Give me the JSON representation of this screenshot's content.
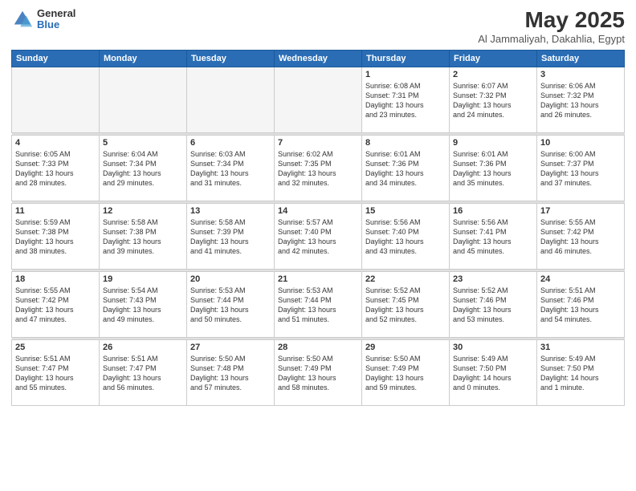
{
  "header": {
    "logo_general": "General",
    "logo_blue": "Blue",
    "title": "May 2025",
    "subtitle": "Al Jammaliyah, Dakahlia, Egypt"
  },
  "days_of_week": [
    "Sunday",
    "Monday",
    "Tuesday",
    "Wednesday",
    "Thursday",
    "Friday",
    "Saturday"
  ],
  "weeks": [
    [
      {
        "day": "",
        "info": ""
      },
      {
        "day": "",
        "info": ""
      },
      {
        "day": "",
        "info": ""
      },
      {
        "day": "",
        "info": ""
      },
      {
        "day": "1",
        "info": "Sunrise: 6:08 AM\nSunset: 7:31 PM\nDaylight: 13 hours\nand 23 minutes."
      },
      {
        "day": "2",
        "info": "Sunrise: 6:07 AM\nSunset: 7:32 PM\nDaylight: 13 hours\nand 24 minutes."
      },
      {
        "day": "3",
        "info": "Sunrise: 6:06 AM\nSunset: 7:32 PM\nDaylight: 13 hours\nand 26 minutes."
      }
    ],
    [
      {
        "day": "4",
        "info": "Sunrise: 6:05 AM\nSunset: 7:33 PM\nDaylight: 13 hours\nand 28 minutes."
      },
      {
        "day": "5",
        "info": "Sunrise: 6:04 AM\nSunset: 7:34 PM\nDaylight: 13 hours\nand 29 minutes."
      },
      {
        "day": "6",
        "info": "Sunrise: 6:03 AM\nSunset: 7:34 PM\nDaylight: 13 hours\nand 31 minutes."
      },
      {
        "day": "7",
        "info": "Sunrise: 6:02 AM\nSunset: 7:35 PM\nDaylight: 13 hours\nand 32 minutes."
      },
      {
        "day": "8",
        "info": "Sunrise: 6:01 AM\nSunset: 7:36 PM\nDaylight: 13 hours\nand 34 minutes."
      },
      {
        "day": "9",
        "info": "Sunrise: 6:01 AM\nSunset: 7:36 PM\nDaylight: 13 hours\nand 35 minutes."
      },
      {
        "day": "10",
        "info": "Sunrise: 6:00 AM\nSunset: 7:37 PM\nDaylight: 13 hours\nand 37 minutes."
      }
    ],
    [
      {
        "day": "11",
        "info": "Sunrise: 5:59 AM\nSunset: 7:38 PM\nDaylight: 13 hours\nand 38 minutes."
      },
      {
        "day": "12",
        "info": "Sunrise: 5:58 AM\nSunset: 7:38 PM\nDaylight: 13 hours\nand 39 minutes."
      },
      {
        "day": "13",
        "info": "Sunrise: 5:58 AM\nSunset: 7:39 PM\nDaylight: 13 hours\nand 41 minutes."
      },
      {
        "day": "14",
        "info": "Sunrise: 5:57 AM\nSunset: 7:40 PM\nDaylight: 13 hours\nand 42 minutes."
      },
      {
        "day": "15",
        "info": "Sunrise: 5:56 AM\nSunset: 7:40 PM\nDaylight: 13 hours\nand 43 minutes."
      },
      {
        "day": "16",
        "info": "Sunrise: 5:56 AM\nSunset: 7:41 PM\nDaylight: 13 hours\nand 45 minutes."
      },
      {
        "day": "17",
        "info": "Sunrise: 5:55 AM\nSunset: 7:42 PM\nDaylight: 13 hours\nand 46 minutes."
      }
    ],
    [
      {
        "day": "18",
        "info": "Sunrise: 5:55 AM\nSunset: 7:42 PM\nDaylight: 13 hours\nand 47 minutes."
      },
      {
        "day": "19",
        "info": "Sunrise: 5:54 AM\nSunset: 7:43 PM\nDaylight: 13 hours\nand 49 minutes."
      },
      {
        "day": "20",
        "info": "Sunrise: 5:53 AM\nSunset: 7:44 PM\nDaylight: 13 hours\nand 50 minutes."
      },
      {
        "day": "21",
        "info": "Sunrise: 5:53 AM\nSunset: 7:44 PM\nDaylight: 13 hours\nand 51 minutes."
      },
      {
        "day": "22",
        "info": "Sunrise: 5:52 AM\nSunset: 7:45 PM\nDaylight: 13 hours\nand 52 minutes."
      },
      {
        "day": "23",
        "info": "Sunrise: 5:52 AM\nSunset: 7:46 PM\nDaylight: 13 hours\nand 53 minutes."
      },
      {
        "day": "24",
        "info": "Sunrise: 5:51 AM\nSunset: 7:46 PM\nDaylight: 13 hours\nand 54 minutes."
      }
    ],
    [
      {
        "day": "25",
        "info": "Sunrise: 5:51 AM\nSunset: 7:47 PM\nDaylight: 13 hours\nand 55 minutes."
      },
      {
        "day": "26",
        "info": "Sunrise: 5:51 AM\nSunset: 7:47 PM\nDaylight: 13 hours\nand 56 minutes."
      },
      {
        "day": "27",
        "info": "Sunrise: 5:50 AM\nSunset: 7:48 PM\nDaylight: 13 hours\nand 57 minutes."
      },
      {
        "day": "28",
        "info": "Sunrise: 5:50 AM\nSunset: 7:49 PM\nDaylight: 13 hours\nand 58 minutes."
      },
      {
        "day": "29",
        "info": "Sunrise: 5:50 AM\nSunset: 7:49 PM\nDaylight: 13 hours\nand 59 minutes."
      },
      {
        "day": "30",
        "info": "Sunrise: 5:49 AM\nSunset: 7:50 PM\nDaylight: 14 hours\nand 0 minutes."
      },
      {
        "day": "31",
        "info": "Sunrise: 5:49 AM\nSunset: 7:50 PM\nDaylight: 14 hours\nand 1 minute."
      }
    ]
  ]
}
